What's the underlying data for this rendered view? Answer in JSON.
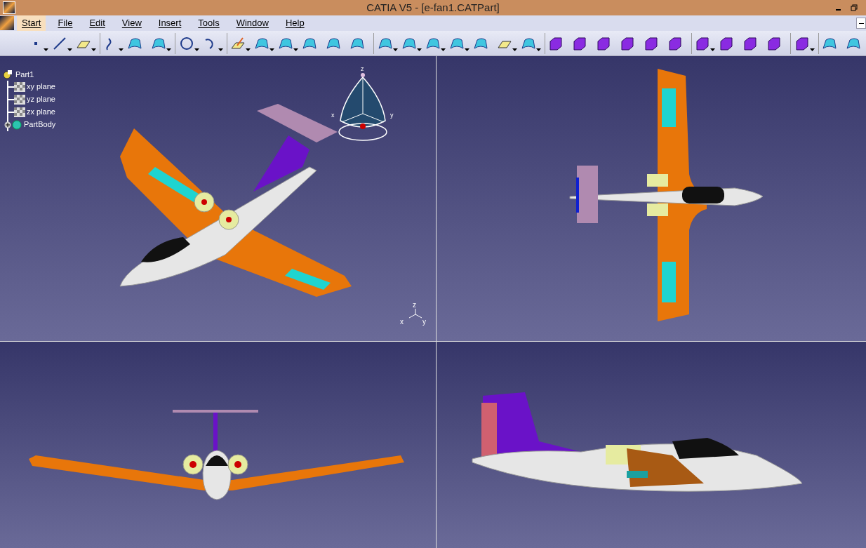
{
  "window": {
    "title": "CATIA V5 - [e-fan1.CATPart]"
  },
  "menu": [
    {
      "label": "Start",
      "selected": true
    },
    {
      "label": "File",
      "selected": false
    },
    {
      "label": "Edit",
      "selected": false
    },
    {
      "label": "View",
      "selected": false
    },
    {
      "label": "Insert",
      "selected": false
    },
    {
      "label": "Tools",
      "selected": false
    },
    {
      "label": "Window",
      "selected": false
    },
    {
      "label": "Help",
      "selected": false
    }
  ],
  "tree": {
    "label": "Part1",
    "children": [
      {
        "label": "xy plane",
        "kind": "plane"
      },
      {
        "label": "yz plane",
        "kind": "plane"
      },
      {
        "label": "zx plane",
        "kind": "plane"
      },
      {
        "label": "PartBody",
        "kind": "body",
        "expanded": false
      }
    ]
  },
  "compass": {
    "z": "z",
    "x": "x",
    "y": "y"
  },
  "axis": {
    "z": "z",
    "x": "x",
    "y": "y"
  }
}
